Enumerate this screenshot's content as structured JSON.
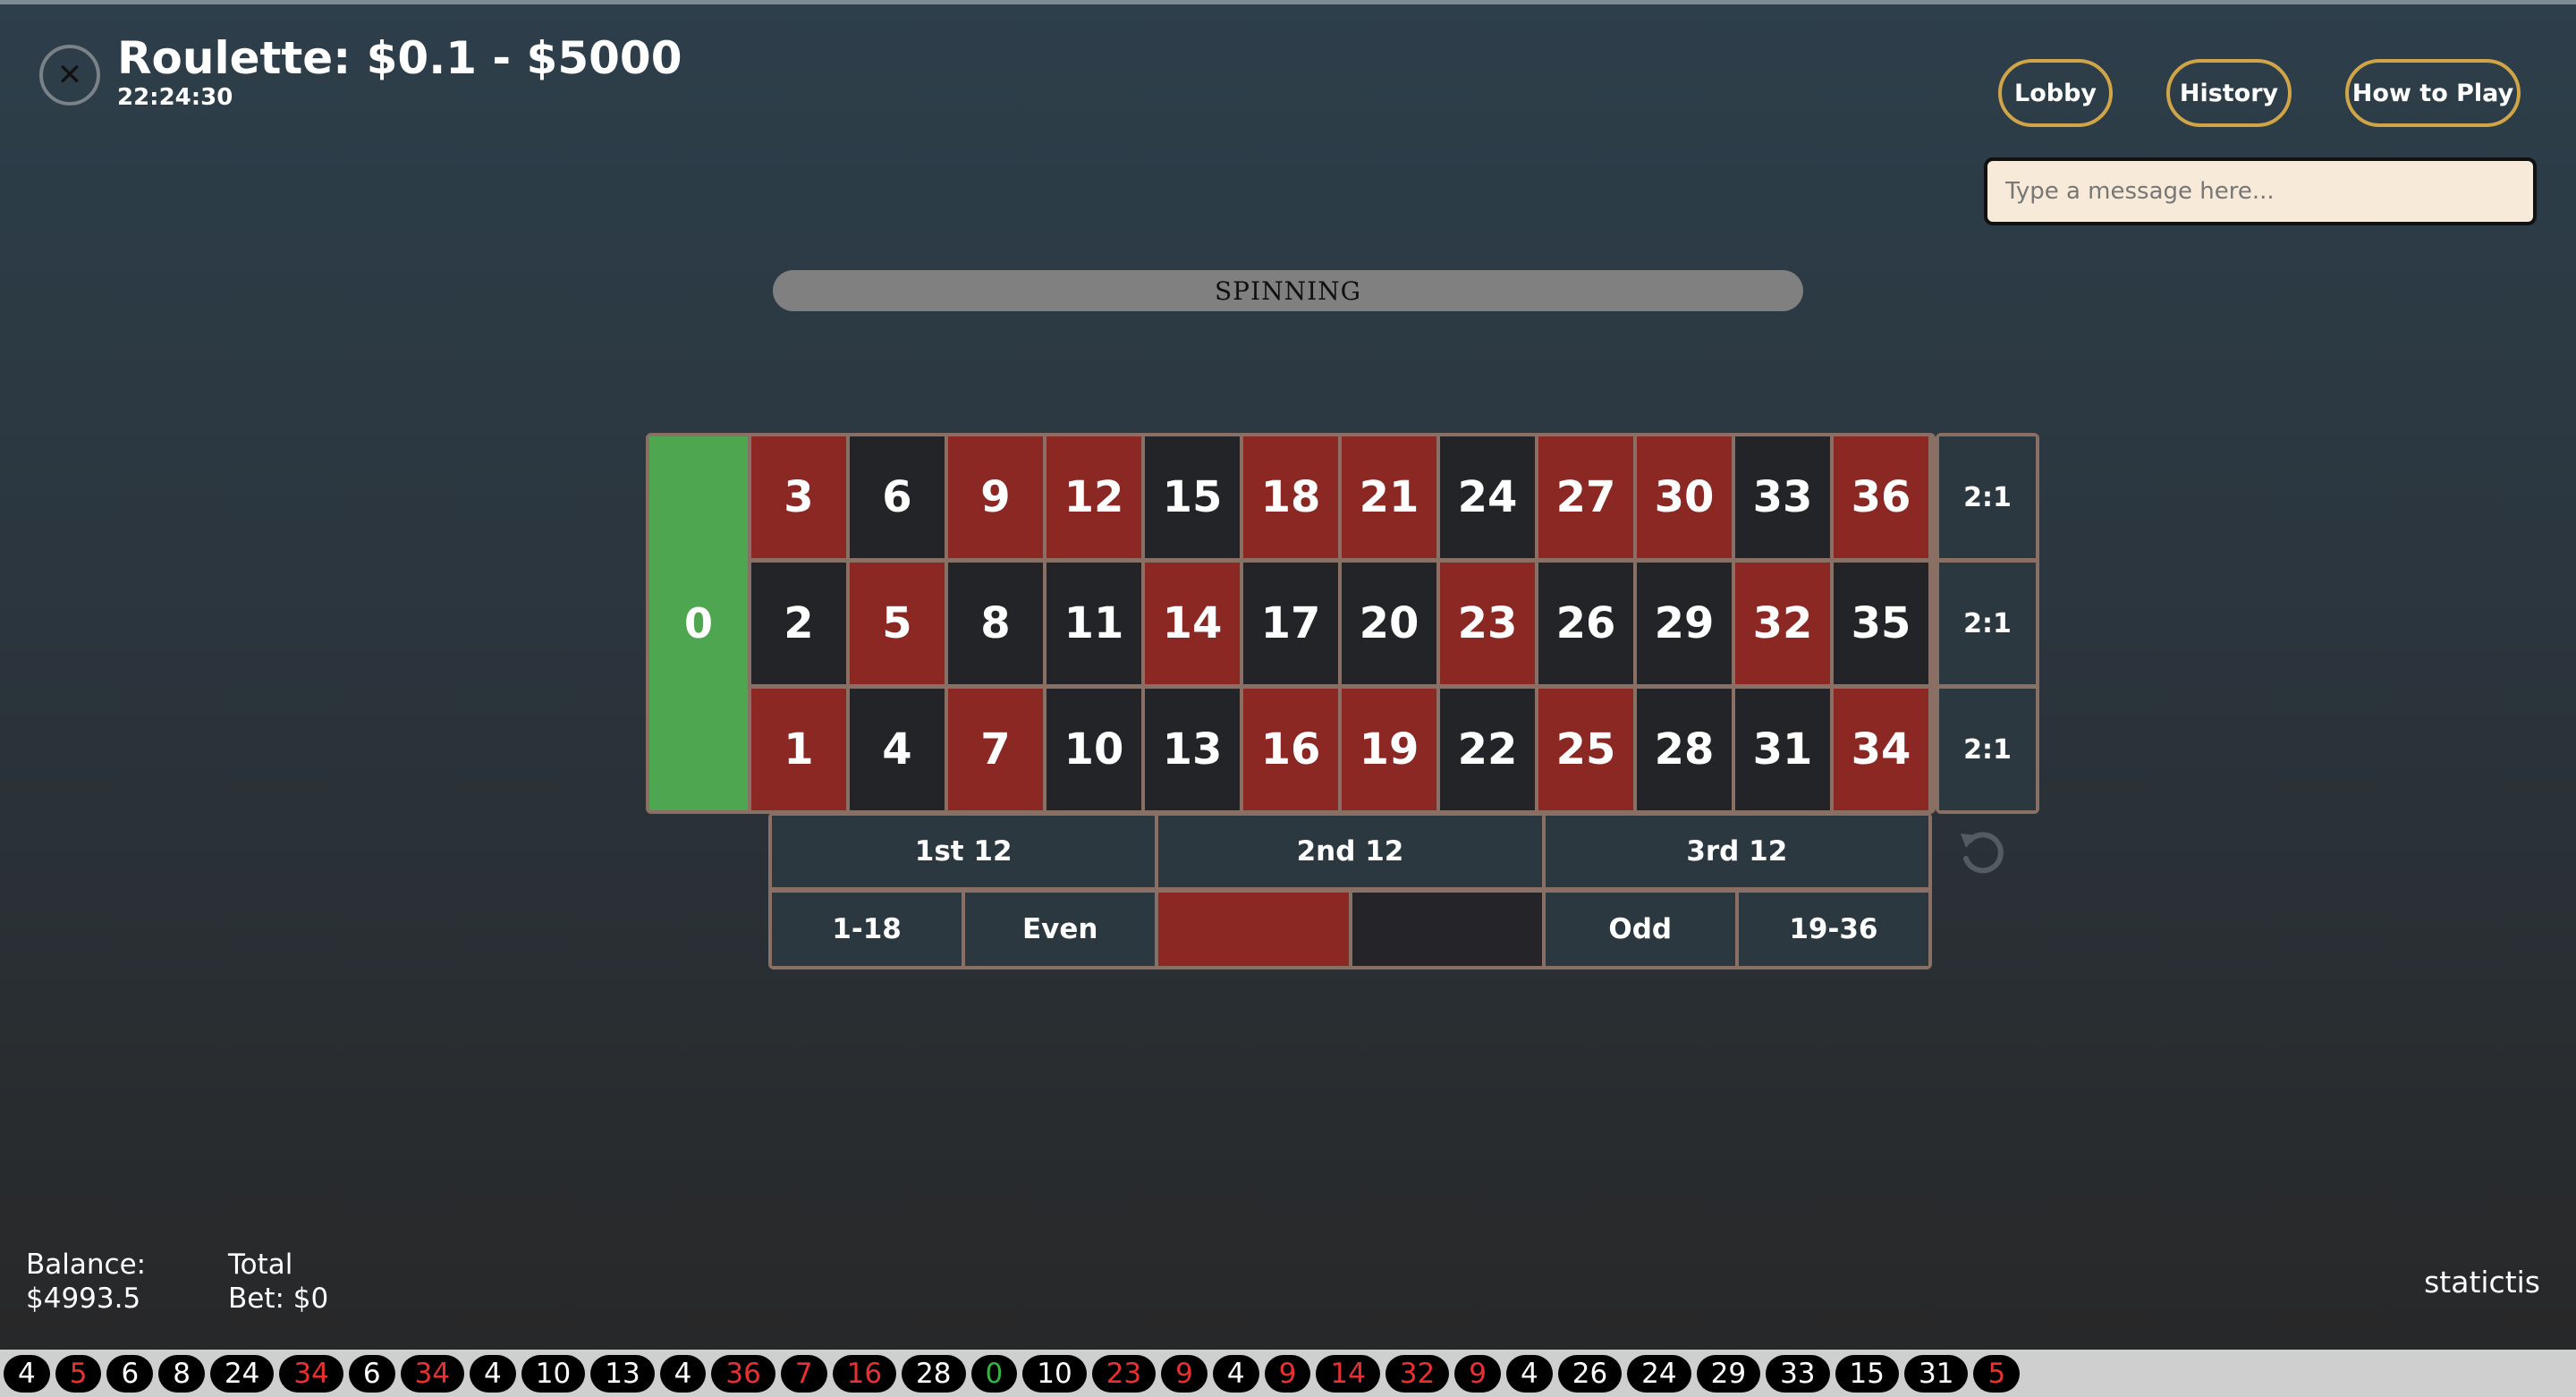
{
  "header": {
    "close_icon": "✕",
    "title": "Roulette: $0.1 - $5000",
    "clock": "22:24:30"
  },
  "nav": {
    "lobby": "Lobby",
    "history": "History",
    "how_to_play": "How to Play"
  },
  "chat": {
    "placeholder": "Type a message here..."
  },
  "status": "SPINNING",
  "table": {
    "zero": "0",
    "rows": [
      [
        {
          "n": "3",
          "c": "red"
        },
        {
          "n": "6",
          "c": "black"
        },
        {
          "n": "9",
          "c": "red"
        },
        {
          "n": "12",
          "c": "red"
        },
        {
          "n": "15",
          "c": "black"
        },
        {
          "n": "18",
          "c": "red"
        },
        {
          "n": "21",
          "c": "red"
        },
        {
          "n": "24",
          "c": "black"
        },
        {
          "n": "27",
          "c": "red"
        },
        {
          "n": "30",
          "c": "red"
        },
        {
          "n": "33",
          "c": "black"
        },
        {
          "n": "36",
          "c": "red"
        }
      ],
      [
        {
          "n": "2",
          "c": "black"
        },
        {
          "n": "5",
          "c": "red"
        },
        {
          "n": "8",
          "c": "black"
        },
        {
          "n": "11",
          "c": "black"
        },
        {
          "n": "14",
          "c": "red"
        },
        {
          "n": "17",
          "c": "black"
        },
        {
          "n": "20",
          "c": "black"
        },
        {
          "n": "23",
          "c": "red"
        },
        {
          "n": "26",
          "c": "black"
        },
        {
          "n": "29",
          "c": "black"
        },
        {
          "n": "32",
          "c": "red"
        },
        {
          "n": "35",
          "c": "black"
        }
      ],
      [
        {
          "n": "1",
          "c": "red"
        },
        {
          "n": "4",
          "c": "black"
        },
        {
          "n": "7",
          "c": "red"
        },
        {
          "n": "10",
          "c": "black"
        },
        {
          "n": "13",
          "c": "black"
        },
        {
          "n": "16",
          "c": "red"
        },
        {
          "n": "19",
          "c": "red"
        },
        {
          "n": "22",
          "c": "black"
        },
        {
          "n": "25",
          "c": "red"
        },
        {
          "n": "28",
          "c": "black"
        },
        {
          "n": "31",
          "c": "black"
        },
        {
          "n": "34",
          "c": "red"
        }
      ]
    ],
    "column_bets": [
      "2:1",
      "2:1",
      "2:1"
    ],
    "dozens": [
      "1st 12",
      "2nd 12",
      "3rd 12"
    ],
    "outside": {
      "low": "1-18",
      "even": "Even",
      "odd": "Odd",
      "high": "19-36"
    },
    "colors": {
      "red": "#8b2824",
      "black": "#232428",
      "green": "#4ea651"
    }
  },
  "undo_icon": "undo-icon",
  "footer": {
    "balance_label": "Balance:",
    "balance_value": "$4993.5",
    "total_label": "Total",
    "total_value": "Bet: $0",
    "stats": "statictis"
  },
  "history_numbers": [
    {
      "n": "4",
      "c": "white"
    },
    {
      "n": "5",
      "c": "red"
    },
    {
      "n": "6",
      "c": "white"
    },
    {
      "n": "8",
      "c": "white"
    },
    {
      "n": "24",
      "c": "white"
    },
    {
      "n": "34",
      "c": "red"
    },
    {
      "n": "6",
      "c": "white"
    },
    {
      "n": "34",
      "c": "red"
    },
    {
      "n": "4",
      "c": "white"
    },
    {
      "n": "10",
      "c": "white"
    },
    {
      "n": "13",
      "c": "white"
    },
    {
      "n": "4",
      "c": "white"
    },
    {
      "n": "36",
      "c": "red"
    },
    {
      "n": "7",
      "c": "red"
    },
    {
      "n": "16",
      "c": "red"
    },
    {
      "n": "28",
      "c": "white"
    },
    {
      "n": "0",
      "c": "green"
    },
    {
      "n": "10",
      "c": "white"
    },
    {
      "n": "23",
      "c": "red"
    },
    {
      "n": "9",
      "c": "red"
    },
    {
      "n": "4",
      "c": "white"
    },
    {
      "n": "9",
      "c": "red"
    },
    {
      "n": "14",
      "c": "red"
    },
    {
      "n": "32",
      "c": "red"
    },
    {
      "n": "9",
      "c": "red"
    },
    {
      "n": "4",
      "c": "white"
    },
    {
      "n": "26",
      "c": "white"
    },
    {
      "n": "24",
      "c": "white"
    },
    {
      "n": "29",
      "c": "white"
    },
    {
      "n": "33",
      "c": "white"
    },
    {
      "n": "15",
      "c": "white"
    },
    {
      "n": "31",
      "c": "white"
    },
    {
      "n": "5",
      "c": "red"
    }
  ]
}
